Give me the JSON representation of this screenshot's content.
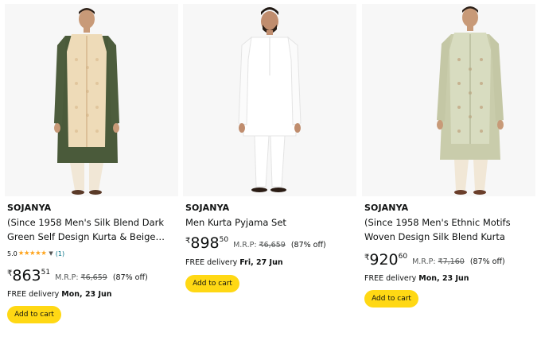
{
  "products": [
    {
      "brand": "SOJANYA",
      "title": "(Since 1958 Men's Silk Blend Dark Green Self Design Kurta & Beige…",
      "rating": "5.0",
      "stars": "★★★★★",
      "rating_count": "(1)",
      "currency": "₹",
      "price_whole": "863",
      "price_fraction": "51",
      "mrp_label": "M.R.P:",
      "mrp_value": "₹6,659",
      "discount": "(87% off)",
      "delivery_prefix": "FREE delivery",
      "delivery_date": "Mon, 23 Jun",
      "cart_label": "Add to cart"
    },
    {
      "brand": "SOJANYA",
      "title": "Men Kurta Pyjama Set",
      "currency": "₹",
      "price_whole": "898",
      "price_fraction": "50",
      "mrp_label": "M.R.P:",
      "mrp_value": "₹6,659",
      "discount": "(87% off)",
      "delivery_prefix": "FREE delivery",
      "delivery_date": "Fri, 27 Jun",
      "cart_label": "Add to cart"
    },
    {
      "brand": "SOJANYA",
      "title": "(Since 1958 Men's Ethnic Motifs Woven Design Silk Blend Kurta With…",
      "currency": "₹",
      "price_whole": "920",
      "price_fraction": "60",
      "mrp_label": "M.R.P:",
      "mrp_value": "₹7,160",
      "discount": "(87% off)",
      "delivery_prefix": "FREE delivery",
      "delivery_date": "Mon, 23 Jun",
      "cart_label": "Add to cart"
    }
  ],
  "colors": {
    "cart_button": "#ffd814",
    "star": "#ffa41c",
    "link": "#007185"
  }
}
